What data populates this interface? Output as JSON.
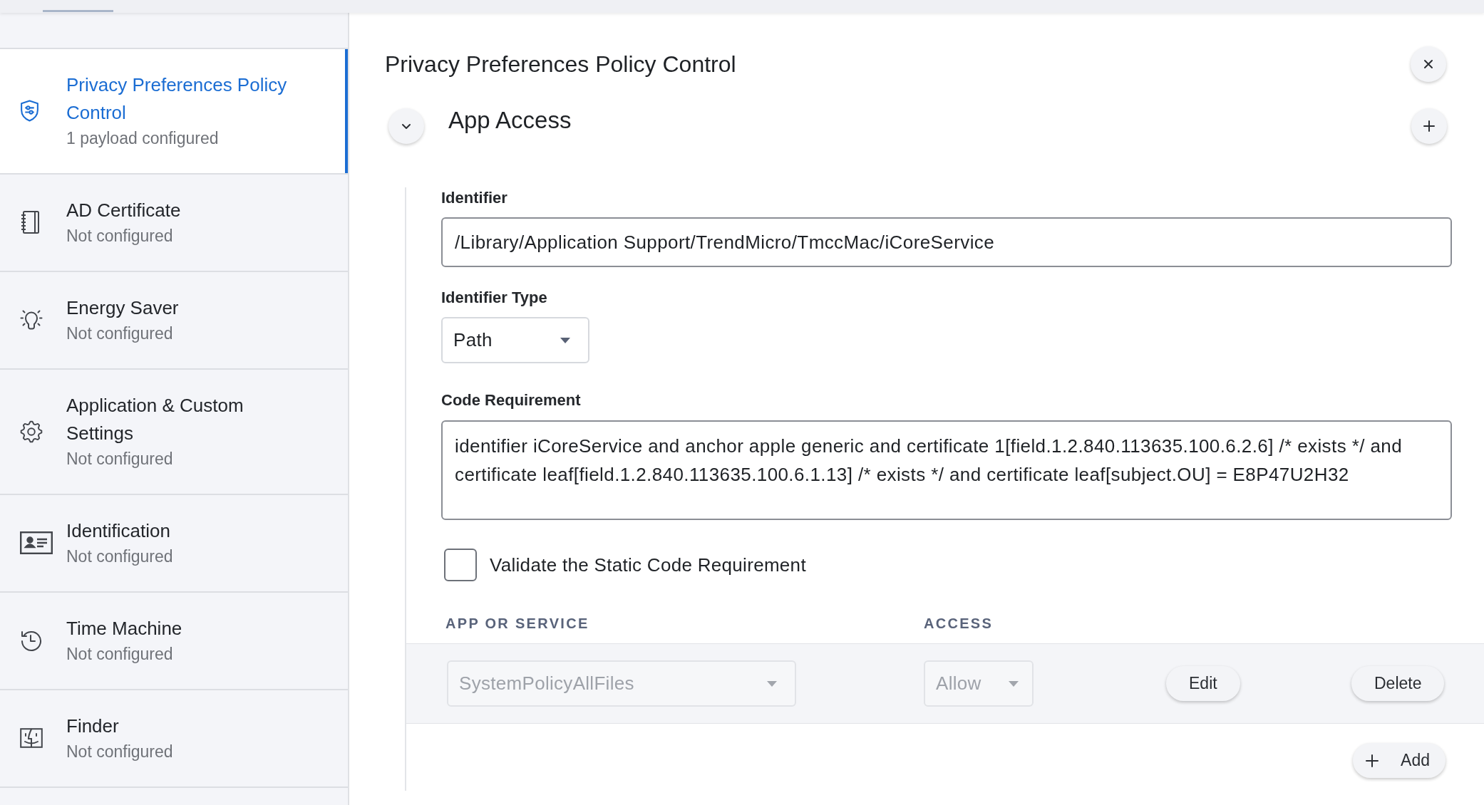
{
  "sidebar": {
    "items": [
      {
        "title": "Privacy Preferences Policy Control",
        "subtitle": "1 payload configured",
        "selected": true
      },
      {
        "title": "AD Certificate",
        "subtitle": "Not configured",
        "selected": false
      },
      {
        "title": "Energy Saver",
        "subtitle": "Not configured",
        "selected": false
      },
      {
        "title": "Application & Custom Settings",
        "subtitle": "Not configured",
        "selected": false
      },
      {
        "title": "Identification",
        "subtitle": "Not configured",
        "selected": false
      },
      {
        "title": "Time Machine",
        "subtitle": "Not configured",
        "selected": false
      },
      {
        "title": "Finder",
        "subtitle": "Not configured",
        "selected": false
      }
    ]
  },
  "panel": {
    "title": "Privacy Preferences Policy Control"
  },
  "section": {
    "title": "App Access",
    "expanded": true,
    "fields": [
      {
        "kind": "text",
        "label": "Identifier",
        "value": "/Library/Application Support/TrendMicro/TmccMac/iCoreService"
      },
      {
        "kind": "select",
        "label": "Identifier Type",
        "value": "Path"
      },
      {
        "kind": "textarea",
        "label": "Code Requirement",
        "value": "identifier iCoreService and anchor apple generic and certificate 1[field.1.2.840.113635.100.6.2.6] /* exists */ and certificate leaf[field.1.2.840.113635.100.6.1.13] /* exists */ and certificate leaf[subject.OU] = E8P47U2H32"
      },
      {
        "kind": "checkbox",
        "label": "Validate the Static Code Requirement",
        "checked": false
      }
    ],
    "table": {
      "columns": [
        "APP OR SERVICE",
        "ACCESS"
      ],
      "rows": [
        {
          "service": "SystemPolicyAllFiles",
          "access": "Allow",
          "disabled": true,
          "actions": [
            "Edit",
            "Delete"
          ]
        }
      ]
    },
    "add_button": "Add"
  }
}
